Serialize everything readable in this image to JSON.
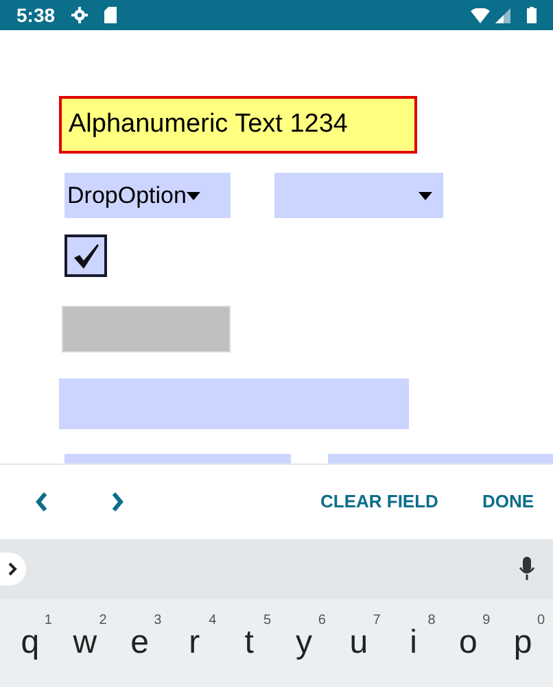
{
  "status_bar": {
    "time": "5:38"
  },
  "form": {
    "text_field": {
      "value": "Alphanumeric Text 1234"
    },
    "dropdowns": [
      {
        "kind": "dropdown",
        "value": "DropOption"
      },
      {
        "kind": "dropdown"
      }
    ],
    "checkbox": {
      "checked": true
    }
  },
  "accessory_bar": {
    "clear": "CLEAR FIELD",
    "done": "DONE"
  },
  "keyboard": {
    "keys": [
      {
        "label": "q",
        "hint": "1"
      },
      {
        "label": "w",
        "hint": "2"
      },
      {
        "label": "e",
        "hint": "3"
      },
      {
        "label": "r",
        "hint": "4"
      },
      {
        "label": "t",
        "hint": "5"
      },
      {
        "label": "y",
        "hint": "6"
      },
      {
        "label": "u",
        "hint": "7"
      },
      {
        "label": "i",
        "hint": "8"
      },
      {
        "label": "o",
        "hint": "9"
      },
      {
        "label": "p",
        "hint": "0"
      }
    ]
  }
}
